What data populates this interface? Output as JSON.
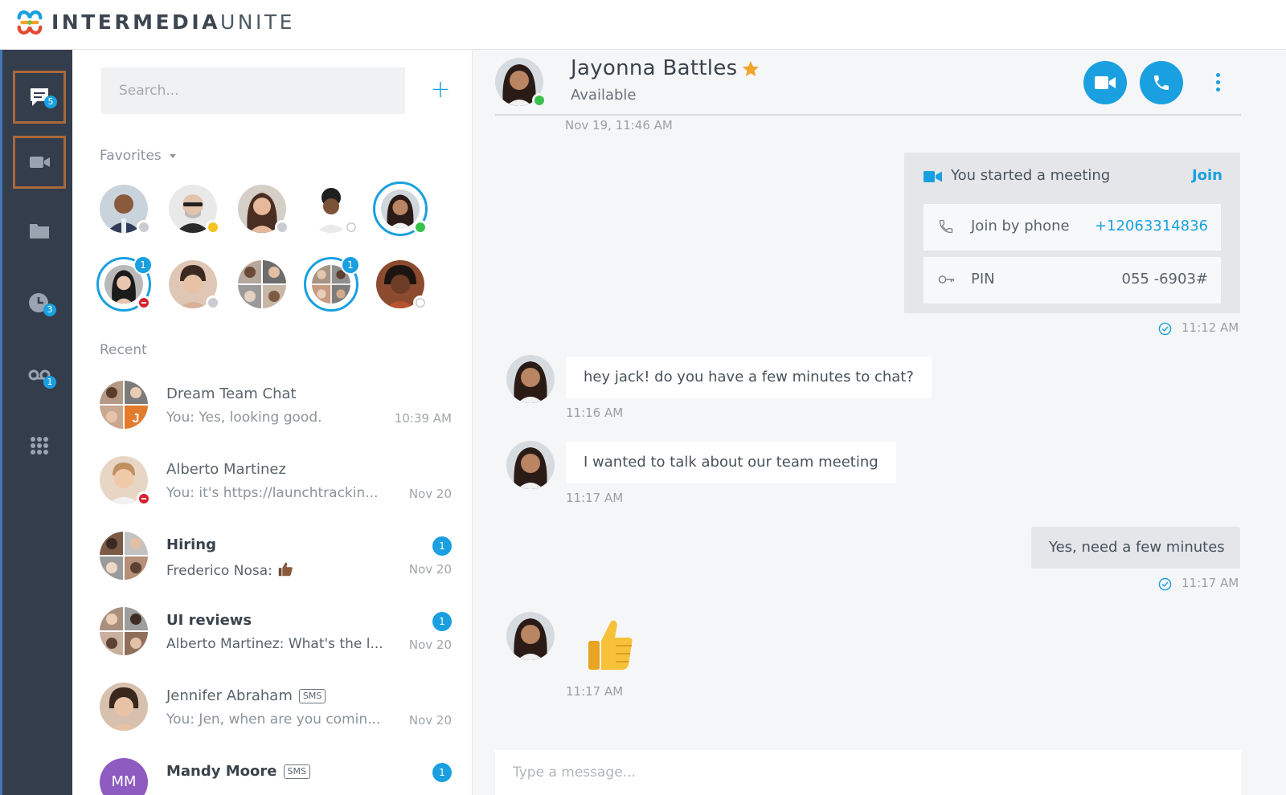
{
  "brand": {
    "name_bold": "INTERMEDIA",
    "name_light": "UNITE"
  },
  "colors": {
    "accent": "#1aa0e0",
    "rail": "#343d4c",
    "rail_active_border": "#a8693c",
    "available": "#38c24d",
    "away": "#c9ccd0",
    "busy": "#f5c320",
    "dnd": "#d8232f",
    "star": "#f2a32c"
  },
  "rail": [
    {
      "icon": "chat-icon",
      "badge": "5",
      "active": true
    },
    {
      "icon": "video-camera-icon",
      "badge": "",
      "active": true
    },
    {
      "icon": "folder-icon",
      "badge": ""
    },
    {
      "icon": "clock-icon",
      "badge": "3"
    },
    {
      "icon": "voicemail-icon",
      "badge": "1"
    },
    {
      "icon": "apps-grid-icon",
      "badge": ""
    }
  ],
  "search": {
    "placeholder": "Search..."
  },
  "add_label": "+",
  "favorites": {
    "label": "Favorites",
    "badges": [
      "1",
      "1"
    ]
  },
  "recent": {
    "label": "Recent",
    "items": [
      {
        "name": "Dream Team Chat",
        "preview": "You: Yes, looking good.",
        "time": "10:39 AM",
        "unread": "",
        "sms": "",
        "bold": false
      },
      {
        "name": "Alberto Martinez",
        "preview": "You: it's https://launchtrackin...",
        "time": "Nov 20",
        "unread": "",
        "sms": "",
        "bold": false
      },
      {
        "name": "Hiring",
        "preview": "Frederico Nosa: ",
        "time": "Nov 20",
        "unread": "1",
        "sms": "",
        "bold": true
      },
      {
        "name": "UI reviews",
        "preview": "Alberto Martinez: What's the l...",
        "time": "Nov 20",
        "unread": "1",
        "sms": "",
        "bold": true
      },
      {
        "name": "Jennifer Abraham",
        "preview": "You: Jen, when are you comin...",
        "time": "Nov 20",
        "unread": "",
        "sms": "SMS",
        "bold": false
      },
      {
        "name": "Mandy Moore",
        "preview": "",
        "time": "",
        "unread": "1",
        "sms": "SMS",
        "bold": true,
        "initials": "MM"
      }
    ]
  },
  "chat": {
    "contact_name": "Jayonna Battles",
    "contact_status": "Available",
    "top_stamp": "Nov 19, 11:46 AM",
    "meeting": {
      "title": "You started a meeting",
      "join_label": "Join",
      "phone_label": "Join by phone",
      "phone_number": "+12063314836",
      "pin_label": "PIN",
      "pin_value": "055 -6903#",
      "time": "11:12 AM"
    },
    "messages": [
      {
        "text": "hey jack! do you have a few minutes to chat?",
        "time": "11:16 AM",
        "direction": "in"
      },
      {
        "text": "I wanted to talk about our team meeting",
        "time": "11:17 AM",
        "direction": "in"
      },
      {
        "text": "Yes, need a few minutes",
        "time": "11:17 AM",
        "direction": "out"
      },
      {
        "text": "",
        "emoji": "thumbs-up-icon",
        "time": "11:17 AM",
        "direction": "in"
      }
    ],
    "composer_placeholder": "Type a message..."
  }
}
